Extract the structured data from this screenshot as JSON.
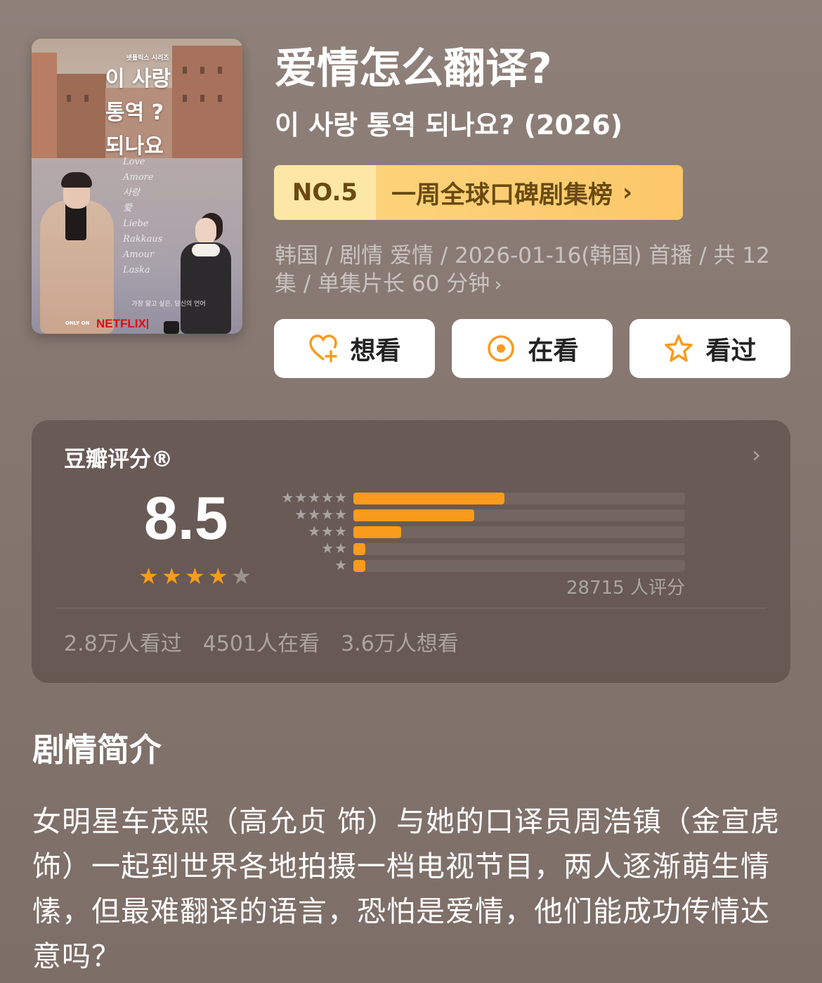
{
  "poster": {
    "title_lines": [
      "이 사랑",
      "통역 ?",
      "되나요"
    ],
    "top_tiny_text": "넷플릭스 시리즈",
    "love_words": [
      "Love",
      "Amore",
      "사랑",
      "爱",
      "Liebe",
      "Rakkaus",
      "Amour",
      "Laska"
    ],
    "tagline": "가장 알고 싶은, 당신의 언어",
    "only_on": "ONLY ON",
    "brand": "NETFLIX"
  },
  "header": {
    "title": "爱情怎么翻译?",
    "original_title": "이 사랑 통역 되나요? (2026)"
  },
  "rank": {
    "number": "NO.5",
    "label": "一周全球口碑剧集榜",
    "chevron": "›"
  },
  "meta": {
    "text": "韩国 / 剧情 爱情 / 2026-01-16(韩国) 首播 / 共 12 集 / 单集片长 60 分钟",
    "chevron": "›"
  },
  "actions": [
    {
      "label": "想看",
      "icon": "heart-plus-icon"
    },
    {
      "label": "在看",
      "icon": "target-circle-icon"
    },
    {
      "label": "看过",
      "icon": "star-outline-icon"
    }
  ],
  "rating": {
    "title": "豆瓣评分®",
    "chevron": "›",
    "score": "8.5",
    "stars": 4,
    "max_stars": 5,
    "distribution": [
      {
        "stars": "★★★★★",
        "fraction": 0.455
      },
      {
        "stars": "★★★★",
        "fraction": 0.365
      },
      {
        "stars": "★★★",
        "fraction": 0.145
      },
      {
        "stars": "★★",
        "fraction": 0.035
      },
      {
        "stars": "★",
        "fraction": 0.035
      }
    ],
    "count_label": "28715 人评分",
    "watch_stats": [
      "2.8万人看过",
      "4501人在看",
      "3.6万人想看"
    ]
  },
  "synopsis": {
    "title": "剧情简介",
    "text": "女明星车茂熙（高允贞 饰）与她的口译员周浩镇（金宣虎 饰）一起到世界各地拍摄一档电视节目，两人逐渐萌生情愫，但最难翻译的语言，恐怕是爱情，他们能成功传情达意吗？"
  },
  "colors": {
    "accent_orange": "#f99b1c",
    "rank_gold": "#fcd37a",
    "rank_text": "#6a4a10",
    "background": "#85766f"
  }
}
